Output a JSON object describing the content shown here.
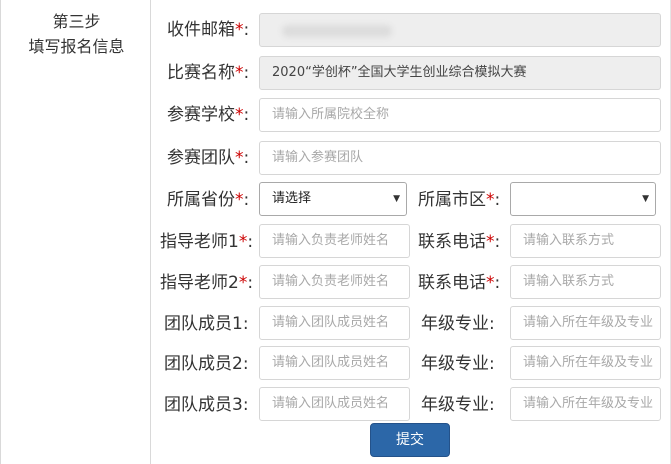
{
  "step": {
    "title": "第三步",
    "subtitle": "填写报名信息"
  },
  "req_mark": "*",
  "colon": ":",
  "fields": {
    "email": {
      "label": "收件邮箱",
      "value": ""
    },
    "contest": {
      "label": "比赛名称",
      "value": "2020“学创杯”全国大学生创业综合模拟大赛"
    },
    "school": {
      "label": "参赛学校",
      "placeholder": "请输入所属院校全称"
    },
    "team": {
      "label": "参赛团队",
      "placeholder": "请输入参赛团队"
    },
    "province": {
      "label": "所属省份",
      "selected": "请选择"
    },
    "city": {
      "label": "所属市区",
      "selected": ""
    },
    "teacher1": {
      "label": "指导老师1",
      "placeholder": "请输入负责老师姓名"
    },
    "phone1": {
      "label": "联系电话",
      "placeholder": "请输入联系方式"
    },
    "teacher2": {
      "label": "指导老师2",
      "placeholder": "请输入负责老师姓名"
    },
    "phone2": {
      "label": "联系电话",
      "placeholder": "请输入联系方式"
    },
    "member1": {
      "label": "团队成员1",
      "placeholder": "请输入团队成员姓名"
    },
    "major1": {
      "label": "年级专业",
      "placeholder": "请输入所在年级及专业"
    },
    "member2": {
      "label": "团队成员2",
      "placeholder": "请输入团队成员姓名"
    },
    "major2": {
      "label": "年级专业",
      "placeholder": "请输入所在年级及专业"
    },
    "member3": {
      "label": "团队成员3",
      "placeholder": "请输入团队成员姓名"
    },
    "major3": {
      "label": "年级专业",
      "placeholder": "请输入所在年级及专业"
    }
  },
  "submit_label": "提交"
}
